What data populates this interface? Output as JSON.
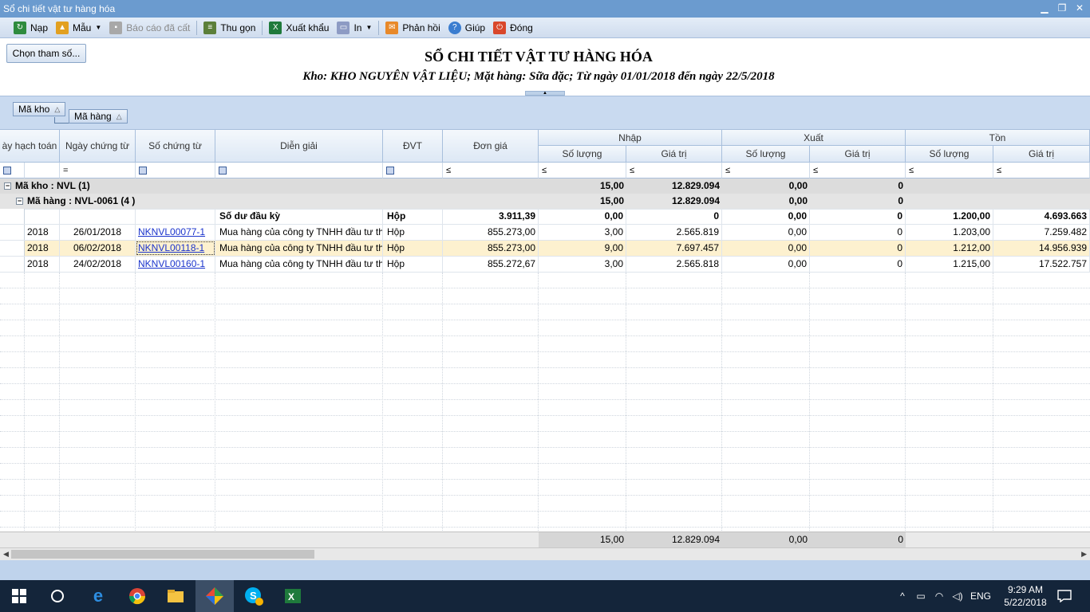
{
  "window": {
    "title": "Sổ chi tiết vật tư hàng hóa",
    "controls": [
      "▁",
      "❐",
      "✕"
    ]
  },
  "toolbar": {
    "nap": "Nạp",
    "mau": "Mẫu",
    "bao_cao_da_cat": "Báo cáo đã cất",
    "thu_gon": "Thu gọn",
    "xuat_khau": "Xuất khẩu",
    "in": "In",
    "phan_hoi": "Phản hồi",
    "giup": "Giúp",
    "dong": "Đóng"
  },
  "header": {
    "params_button": "Chọn tham số...",
    "title": "SỔ CHI TIẾT VẬT TƯ HÀNG HÓA",
    "subtitle": "Kho: KHO NGUYÊN VẬT LIỆU; Mặt hàng: Sữa đặc; Từ ngày 01/01/2018 đến ngày 22/5/2018"
  },
  "group_panel": {
    "chip1": "Mã kho",
    "chip2": "Mã hàng"
  },
  "columns": {
    "ngay_hach_toan": "ày hạch toán",
    "ngay_chung_tu": "Ngày chứng từ",
    "so_chung_tu": "Số chứng từ",
    "dien_giai": "Diễn giải",
    "dvt": "ĐVT",
    "don_gia": "Đơn giá",
    "nhap": "Nhập",
    "xuat": "Xuất",
    "ton": "Tồn",
    "so_luong": "Số lượng",
    "gia_tri": "Giá trị"
  },
  "filters": {
    "eq": "=",
    "le": "≤"
  },
  "groups": {
    "kho": {
      "label": "Mã kho : NVL (1)",
      "nhap_sl": "15,00",
      "nhap_gt": "12.829.094",
      "xuat_sl": "0,00",
      "xuat_gt": "0"
    },
    "hang": {
      "label": "Mã hàng : NVL-0061 (4 )",
      "nhap_sl": "15,00",
      "nhap_gt": "12.829.094",
      "xuat_sl": "0,00",
      "xuat_gt": "0"
    }
  },
  "opening": {
    "dien_giai": "Số dư đầu kỳ",
    "dvt": "Hộp",
    "don_gia": "3.911,39",
    "nhap_sl": "0,00",
    "nhap_gt": "0",
    "xuat_sl": "0,00",
    "xuat_gt": "0",
    "ton_sl": "1.200,00",
    "ton_gt": "4.693.663"
  },
  "rows": [
    {
      "ngay_ht": "2018",
      "ngay_ct": "26/01/2018",
      "so_ct": "NKNVL00077-1",
      "dien_giai": "Mua hàng của công ty TNHH đầu tư thư",
      "dvt": "Hộp",
      "don_gia": "855.273,00",
      "nhap_sl": "3,00",
      "nhap_gt": "2.565.819",
      "xuat_sl": "0,00",
      "xuat_gt": "0",
      "ton_sl": "1.203,00",
      "ton_gt": "7.259.482"
    },
    {
      "ngay_ht": "2018",
      "ngay_ct": "06/02/2018",
      "so_ct": "NKNVL00118-1",
      "dien_giai": "Mua hàng của công ty TNHH đầu tư thư",
      "dvt": "Hộp",
      "don_gia": "855.273,00",
      "nhap_sl": "9,00",
      "nhap_gt": "7.697.457",
      "xuat_sl": "0,00",
      "xuat_gt": "0",
      "ton_sl": "1.212,00",
      "ton_gt": "14.956.939"
    },
    {
      "ngay_ht": "2018",
      "ngay_ct": "24/02/2018",
      "so_ct": "NKNVL00160-1",
      "dien_giai": "Mua hàng của công ty TNHH đầu tư thư",
      "dvt": "Hộp",
      "don_gia": "855.272,67",
      "nhap_sl": "3,00",
      "nhap_gt": "2.565.818",
      "xuat_sl": "0,00",
      "xuat_gt": "0",
      "ton_sl": "1.215,00",
      "ton_gt": "17.522.757"
    }
  ],
  "totals": {
    "nhap_sl": "15,00",
    "nhap_gt": "12.829.094",
    "xuat_sl": "0,00",
    "xuat_gt": "0"
  },
  "taskbar": {
    "lang": "ENG",
    "time": "9:29 AM",
    "date": "5/22/2018"
  }
}
